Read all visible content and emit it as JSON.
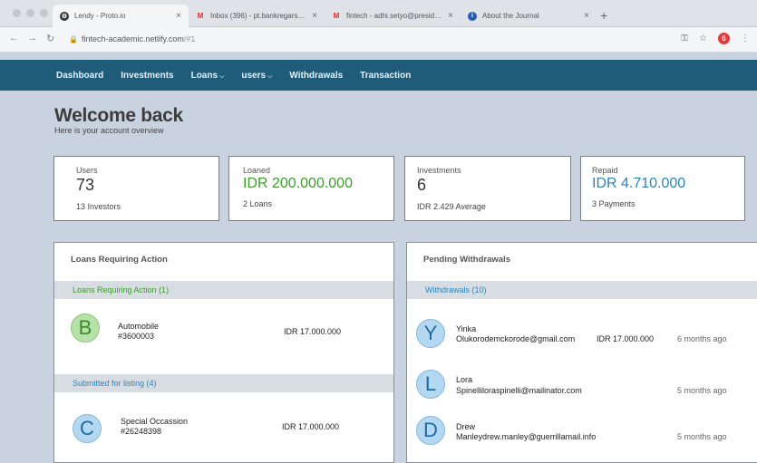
{
  "browser": {
    "tabs": [
      {
        "label": "Lendy - Proto.io",
        "icon": "gear-icon"
      },
      {
        "label": "Inbox (396) - pt.bankregarsip.mail...",
        "icon": "gmail-icon"
      },
      {
        "label": "fintech - adhi.setyo@presiden...",
        "icon": "gmail-icon"
      },
      {
        "label": "About the Journal",
        "icon": "info-icon"
      }
    ],
    "url_host": "fintech-academic.netlify.com",
    "url_path": "/#1",
    "profile_initial": "6"
  },
  "nav": {
    "items": [
      {
        "label": "Dashboard",
        "dropdown": false
      },
      {
        "label": "Investments",
        "dropdown": false
      },
      {
        "label": "Loans",
        "dropdown": true
      },
      {
        "label": "users",
        "dropdown": true
      },
      {
        "label": "Withdrawals",
        "dropdown": false
      },
      {
        "label": "Transaction",
        "dropdown": false
      }
    ]
  },
  "header": {
    "title": "Welcome back",
    "subtitle": "Here is your account overview"
  },
  "stats": [
    {
      "label": "Users",
      "value": "73",
      "sub": "13 Investors",
      "color": "#333333"
    },
    {
      "label": "Loaned",
      "value": "IDR 200.000.000",
      "sub": "2 Loans",
      "color": "#3e9a2a"
    },
    {
      "label": "Investments",
      "value": "6",
      "sub": "IDR 2.429 Average",
      "color": "#333333"
    },
    {
      "label": "Repaid",
      "value": "IDR 4.710.000",
      "sub": "3 Payments",
      "color": "#2a85b5"
    }
  ],
  "loans_panel": {
    "title": "Loans Requiring Action",
    "section1": "Loans Requiring Action (1)",
    "section2": "Submitted for listing (4)",
    "items": [
      {
        "initial": "B",
        "name": "Automobile",
        "id": "#3600003",
        "amount": "IDR 17.000.000"
      },
      {
        "initial": "C",
        "name": "Special Occassion",
        "id": "#26248398",
        "amount": "IDR 17.000.000"
      }
    ]
  },
  "withdrawals_panel": {
    "title": "Pending Withdrawals",
    "section": "Withdrawals (10)",
    "items": [
      {
        "initial": "Y",
        "name": "Yinka",
        "detail": "Olukorodemckorode@gmail.com",
        "amount": "IDR 17.000.000",
        "time": "6 months ago"
      },
      {
        "initial": "L",
        "name": "Lora",
        "detail": "Spinelliloraspinelli@mailinator.com",
        "amount": "",
        "time": "5 months ago"
      },
      {
        "initial": "D",
        "name": "Drew",
        "detail": "Manleydrew.manley@guerrillamail.info",
        "amount": "",
        "time": "5 months ago"
      }
    ]
  }
}
